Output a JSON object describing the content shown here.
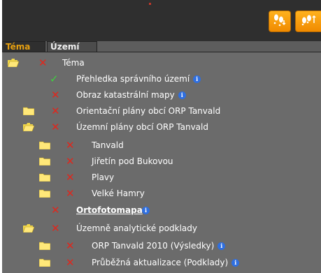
{
  "tabs": [
    "Téma",
    "Území"
  ],
  "rows": [
    {
      "label": "Téma",
      "has_info": false
    },
    {
      "label": "Přehledka správního území",
      "has_info": true
    },
    {
      "label": "Obraz katastrální mapy",
      "has_info": true
    },
    {
      "label": "Orientační plány obcí ORP Tanvald",
      "has_info": false
    },
    {
      "label": "Územní plány obcí ORP Tanvald",
      "has_info": false
    },
    {
      "label": "Tanvald",
      "has_info": false
    },
    {
      "label": "Jiřetín pod Bukovou",
      "has_info": false
    },
    {
      "label": "Plavy",
      "has_info": false
    },
    {
      "label": "Velké Hamry",
      "has_info": false
    },
    {
      "label": "Ortofotomapa",
      "has_info": true
    },
    {
      "label": "Územně analytické podklady",
      "has_info": false
    },
    {
      "label": "ORP Tanvald 2010 (Výsledky)",
      "has_info": true
    },
    {
      "label": "Průběžná aktualizace (Podklady)",
      "has_info": true
    }
  ],
  "icons": {
    "info": "i",
    "checkmark": "✓",
    "cross": "✕"
  },
  "colors": {
    "accent": "#e7a010",
    "panel": "#6b6b6b",
    "header": "#2f2f2f",
    "cross": "#e0271d",
    "check": "#3fd13f",
    "info": "#2f6fe0",
    "button": "#f59a0a"
  }
}
